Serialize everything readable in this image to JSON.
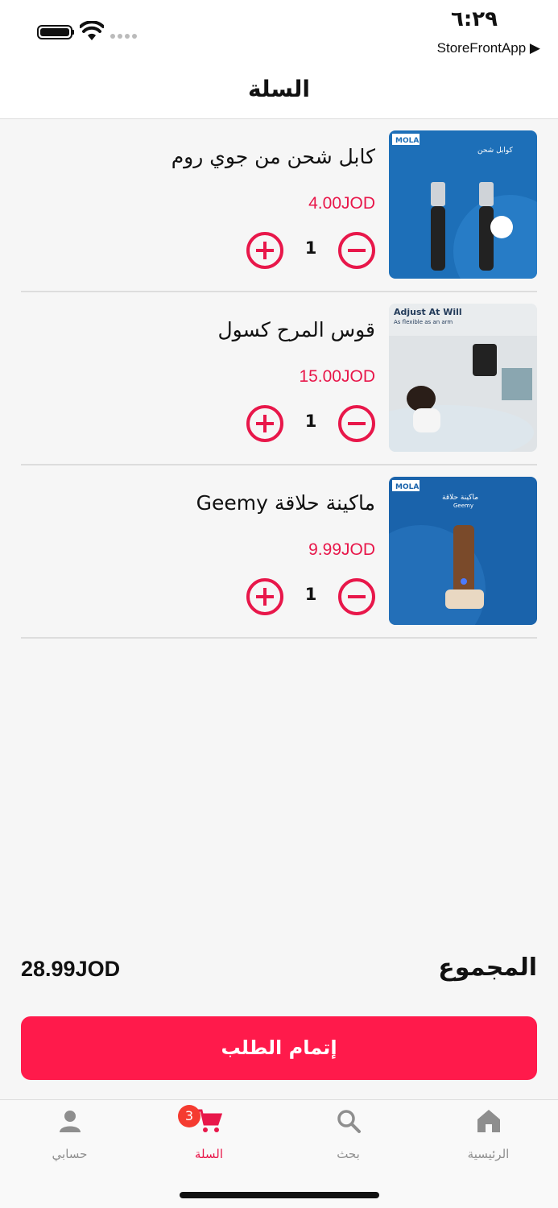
{
  "status_bar": {
    "time": "٦:٢٩",
    "back_app": "StoreFrontApp ▶"
  },
  "header": {
    "title": "السلة"
  },
  "cart": {
    "items": [
      {
        "name": "كابل شحن من جوي روم",
        "price": "4.00JOD",
        "quantity": "1",
        "thumb_text": "كوابل شحن",
        "thumb_brand": "MOLA"
      },
      {
        "name": "قوس المرح كسول",
        "price": "15.00JOD",
        "quantity": "1",
        "thumb_text": "Adjust At Will",
        "thumb_subtext": "As flexible as an arm"
      },
      {
        "name": "ماكينة حلاقة Geemy",
        "price": "9.99JOD",
        "quantity": "1",
        "thumb_text": "ماكينة حلاقة",
        "thumb_subtext": "Geemy",
        "thumb_brand": "MOLA"
      }
    ]
  },
  "summary": {
    "total_label": "المجموع",
    "total_value": "28.99JOD"
  },
  "checkout": {
    "label": "إتمام الطلب"
  },
  "tab_bar": {
    "profile": "حسابي",
    "cart": "السلة",
    "cart_badge": "3",
    "search": "بحث",
    "home": "الرئيسية"
  },
  "colors": {
    "accent": "#ff1a4b",
    "price": "#e8174a",
    "badge": "#f53b30"
  },
  "icons": [
    "battery-icon",
    "wifi-icon",
    "plus-icon",
    "minus-icon",
    "profile-icon",
    "cart-icon",
    "search-icon",
    "home-icon"
  ]
}
